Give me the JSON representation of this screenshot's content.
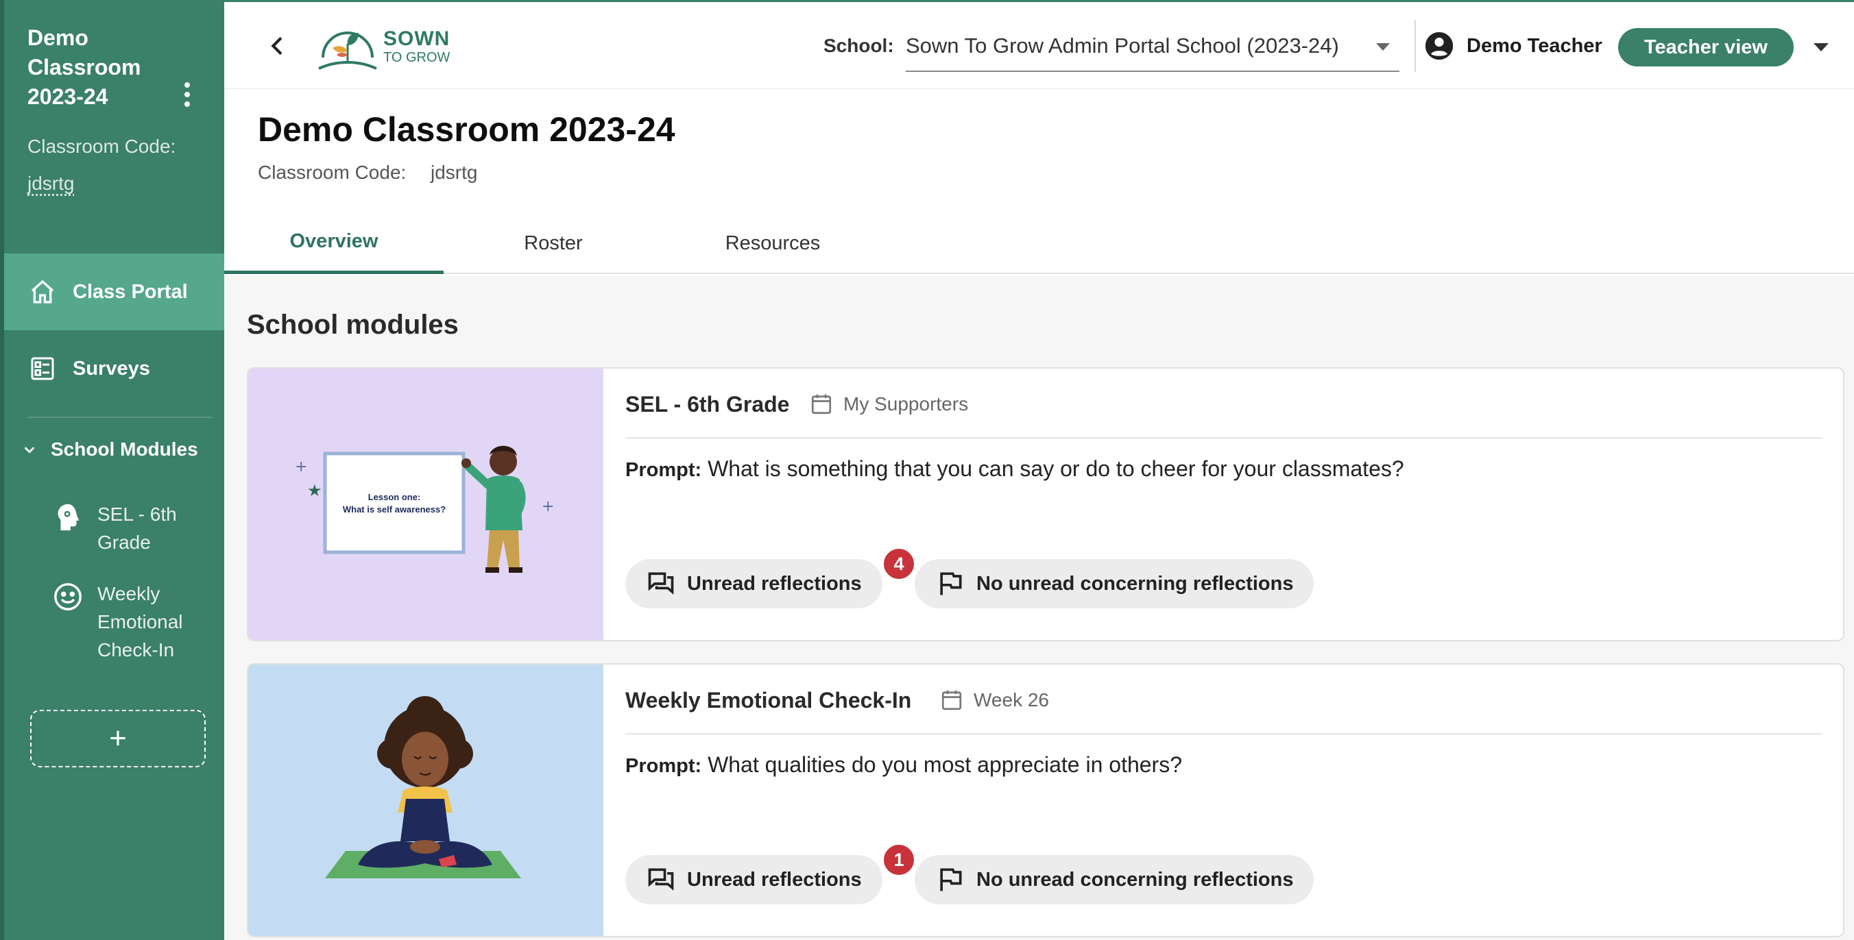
{
  "sidebar": {
    "title": "Demo Classroom 2023-24",
    "code_label": "Classroom Code:",
    "code_value": "jdsrtg",
    "nav": [
      {
        "label": "Class Portal",
        "icon": "home-icon",
        "active": true
      },
      {
        "label": "Surveys",
        "icon": "survey-list-icon",
        "active": false
      }
    ],
    "modules_label": "School Modules",
    "modules": [
      {
        "label": "SEL - 6th Grade",
        "icon": "head-gear-icon"
      },
      {
        "label": "Weekly Emotional Check-In",
        "icon": "smiley-face-icon"
      }
    ],
    "add_label": "+"
  },
  "header": {
    "logo_line1": "SOWN",
    "logo_line2": "TO GROW",
    "school_label": "School:",
    "school_value": "Sown To Grow Admin Portal School (2023-24)",
    "user_name": "Demo Teacher",
    "view_button": "Teacher view"
  },
  "page": {
    "title": "Demo Classroom 2023-24",
    "code_label": "Classroom Code:",
    "code_value": "jdsrtg"
  },
  "tabs": [
    {
      "label": "Overview",
      "active": true
    },
    {
      "label": "Roster",
      "active": false
    },
    {
      "label": "Resources",
      "active": false
    }
  ],
  "section_title": "School modules",
  "cards": [
    {
      "title": "SEL - 6th Grade",
      "meta": "My Supporters",
      "image_text_line1": "Lesson one:",
      "image_text_line2": "What is self awareness?",
      "prompt_label": "Prompt:",
      "prompt": "What is something that you can say or do to cheer for your classmates?",
      "unread_label": "Unread reflections",
      "unread_count": "4",
      "concern_label": "No unread concerning reflections",
      "bg_color": "#e2d6f7"
    },
    {
      "title": "Weekly Emotional Check-In",
      "meta": "Week 26",
      "prompt_label": "Prompt:",
      "prompt": "What qualities do you most appreciate in others?",
      "unread_label": "Unread reflections",
      "unread_count": "1",
      "concern_label": "No unread concerning reflections",
      "bg_color": "#c3dcf3"
    }
  ],
  "colors": {
    "brand_green": "#3b8068",
    "sidebar_active": "#55a88b",
    "badge_red": "#c8323a"
  }
}
